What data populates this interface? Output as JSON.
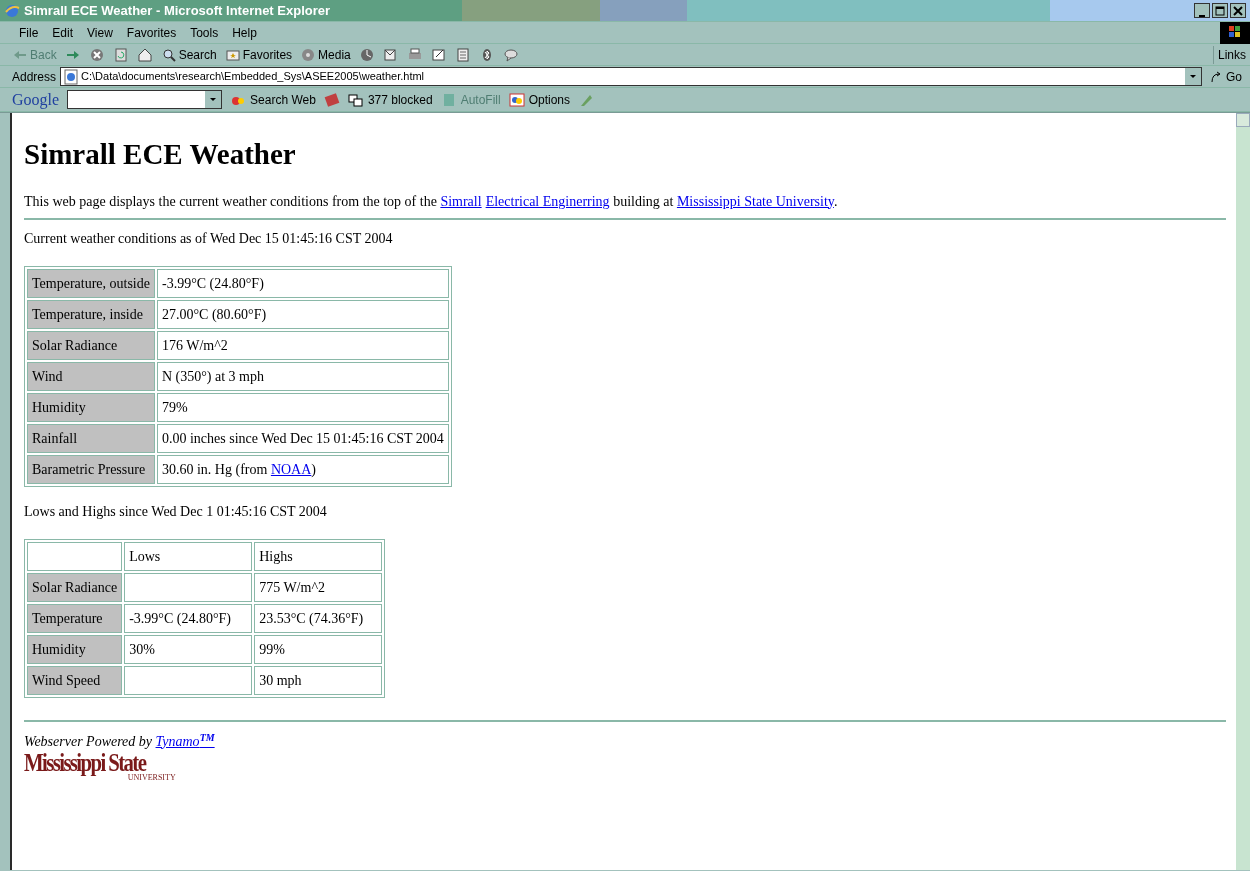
{
  "window": {
    "title": "Simrall ECE Weather - Microsoft Internet Explorer"
  },
  "menu": [
    "File",
    "Edit",
    "View",
    "Favorites",
    "Tools",
    "Help"
  ],
  "toolbar": {
    "buttons": [
      {
        "kind": "back",
        "label": "Back",
        "disabled": true
      },
      {
        "kind": "forward",
        "disabled": false
      },
      {
        "kind": "stop"
      },
      {
        "kind": "refresh"
      },
      {
        "kind": "home"
      },
      {
        "kind": "search",
        "label": "Search"
      },
      {
        "kind": "favorites",
        "label": "Favorites"
      },
      {
        "kind": "media",
        "label": "Media"
      },
      {
        "kind": "history"
      },
      {
        "kind": "mail"
      },
      {
        "kind": "print"
      },
      {
        "kind": "edit"
      },
      {
        "kind": "discuss"
      },
      {
        "kind": "bluetooth"
      },
      {
        "kind": "messenger"
      }
    ],
    "links": "Links"
  },
  "address": {
    "label": "Address",
    "value": "C:\\Data\\documents\\research\\Embedded_Sys\\ASEE2005\\weather.html",
    "go": "Go"
  },
  "google_bar": {
    "logo": "Google",
    "search_web": "Search Web",
    "blocked": "377 blocked",
    "autofill": "AutoFill",
    "options": "Options"
  },
  "page": {
    "heading": "Simrall ECE Weather",
    "intro": [
      {
        "text": "This web page displays the current weather conditions from the top of the "
      },
      {
        "text": "Simrall",
        "link": true
      },
      {
        "text": "Electrical Enginerring",
        "link": true
      },
      {
        "text": " building at "
      },
      {
        "text": "Mississippi State University",
        "link": true
      },
      {
        "text": "."
      }
    ],
    "current_caption": "Current weather conditions as of Wed Dec 15 01:45:16 CST 2004",
    "current": [
      {
        "label": "Temperature, outside",
        "value": [
          {
            "text": "-3.99°C (24.80°F)"
          }
        ]
      },
      {
        "label": "Temperature, inside",
        "value": [
          {
            "text": "27.00°C (80.60°F)"
          }
        ]
      },
      {
        "label": "Solar Radiance",
        "value": [
          {
            "text": "176 W/m^2"
          }
        ]
      },
      {
        "label": "Wind",
        "value": [
          {
            "text": "N (350°) at 3 mph"
          }
        ]
      },
      {
        "label": "Humidity",
        "value": [
          {
            "text": "79%"
          }
        ]
      },
      {
        "label": "Rainfall",
        "value": [
          {
            "text": "0.00 inches since Wed Dec 15 01:45:16 CST 2004"
          }
        ]
      },
      {
        "label": "Barametric Pressure",
        "value": [
          {
            "text": "30.60 in. Hg (from "
          },
          {
            "text": "NOAA",
            "link": true
          },
          {
            "text": ")"
          }
        ]
      }
    ],
    "extremes_caption": "Lows and Highs since Wed Dec 1 01:45:16 CST 2004",
    "extremes_columns": [
      "Lows",
      "Highs"
    ],
    "extremes": [
      {
        "label": "Solar Radiance",
        "high": "775 W/m^2"
      },
      {
        "label": "Temperature",
        "low": "-3.99°C (24.80°F)",
        "high": "23.53°C (74.36°F)"
      },
      {
        "label": "Humidity",
        "low": "30%",
        "high": "99%"
      },
      {
        "label": "Wind Speed",
        "high": "30 mph"
      }
    ],
    "footer": {
      "text": "Webserver Powered by ",
      "link": "Tynamo",
      "mark": "TM",
      "logo": "Mississippi State",
      "logo_sub": "UNIVERSITY"
    }
  }
}
